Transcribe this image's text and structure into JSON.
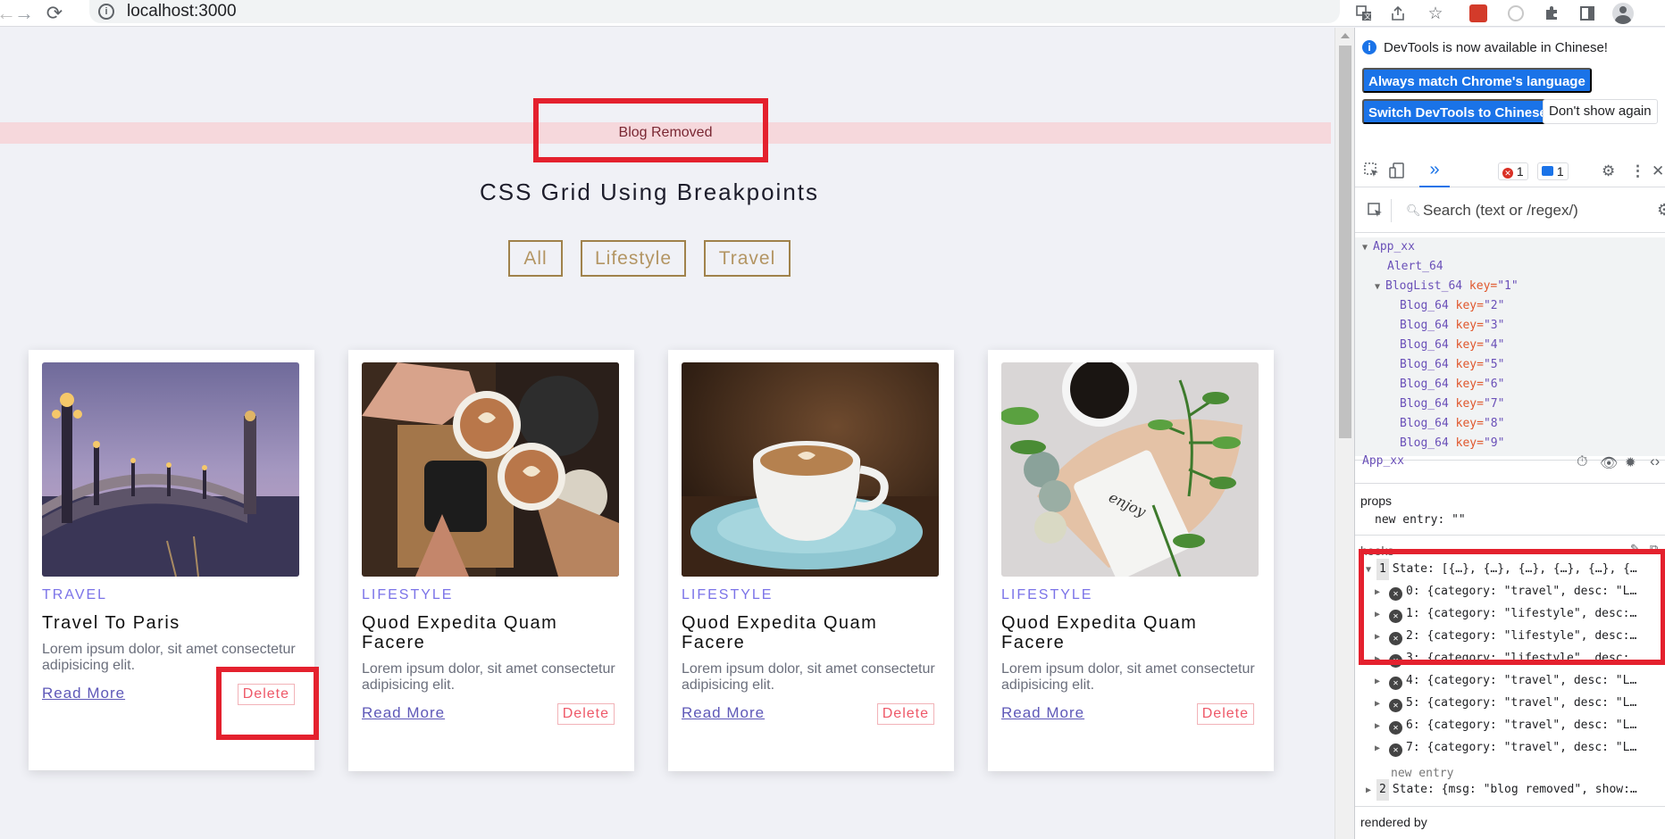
{
  "browser": {
    "url": "localhost:3000"
  },
  "alert": {
    "message": "Blog Removed"
  },
  "page": {
    "title": "CSS Grid Using Breakpoints",
    "filters": [
      "All",
      "Lifestyle",
      "Travel"
    ]
  },
  "blogs": [
    {
      "category": "TRAVEL",
      "title": "Travel To Paris",
      "desc": "Lorem ipsum dolor, sit amet consectetur adipisicing elit.",
      "read_more": "Read More",
      "delete": "Delete"
    },
    {
      "category": "LIFESTYLE",
      "title": "Quod Expedita Quam Facere",
      "desc": "Lorem ipsum dolor, sit amet consectetur adipisicing elit.",
      "read_more": "Read More",
      "delete": "Delete"
    },
    {
      "category": "LIFESTYLE",
      "title": "Quod Expedita Quam Facere",
      "desc": "Lorem ipsum dolor, sit amet consectetur adipisicing elit.",
      "read_more": "Read More",
      "delete": "Delete"
    },
    {
      "category": "LIFESTYLE",
      "title": "Quod Expedita Quam Facere",
      "desc": "Lorem ipsum dolor, sit amet consectetur adipisicing elit.",
      "read_more": "Read More",
      "delete": "Delete"
    }
  ],
  "devtools": {
    "notice": "DevTools is now available in Chinese!",
    "btn_match": "Always match Chrome's language",
    "btn_switch": "Switch DevTools to Chinese",
    "btn_dont_show": "Don't show again",
    "error_count": "1",
    "message_count": "1",
    "search_placeholder": "Search (text or /regex/)",
    "tree": {
      "root": "App_xx",
      "alert": "Alert_64",
      "bloglist": "BlogList_64",
      "bloglist_key_attr": "key=",
      "bloglist_key_val": "\"1\"",
      "blog_name": "Blog_64",
      "blog_keys": [
        "\"2\"",
        "\"3\"",
        "\"4\"",
        "\"5\"",
        "\"6\"",
        "\"7\"",
        "\"8\"",
        "\"9\""
      ]
    },
    "selected_component": "App_xx",
    "props_title": "props",
    "props_entry": "new entry: \"\"",
    "hooks_title": "hooks",
    "state1": "State: [{…}, {…}, {…}, {…}, {…}, {…",
    "state1_index": "1",
    "state_items": [
      "0: {category: \"travel\", desc: \"L…",
      "1: {category: \"lifestyle\", desc:…",
      "2: {category: \"lifestyle\", desc:…",
      "3: {category: \"lifestyle\", desc:…",
      "4: {category: \"travel\", desc: \"L…",
      "5: {category: \"travel\", desc: \"L…",
      "6: {category: \"travel\", desc: \"L…",
      "7: {category: \"travel\", desc: \"L…"
    ],
    "new_entry": "new entry",
    "state2_index": "2",
    "state2": "State: {msg: \"blog removed\", show:…",
    "rendered_by": "rendered by"
  },
  "colors": {
    "accent": "#7b73e8",
    "highlight": "#e4212e",
    "filter_border": "#a0824b",
    "delete_text": "#ee5868"
  },
  "icons": [
    "forward-arrow-icon",
    "reload-icon",
    "info-icon",
    "translate-icon",
    "share-icon",
    "star-icon",
    "extension-icon",
    "puzzle-icon",
    "sidepanel-icon",
    "profile-icon"
  ]
}
